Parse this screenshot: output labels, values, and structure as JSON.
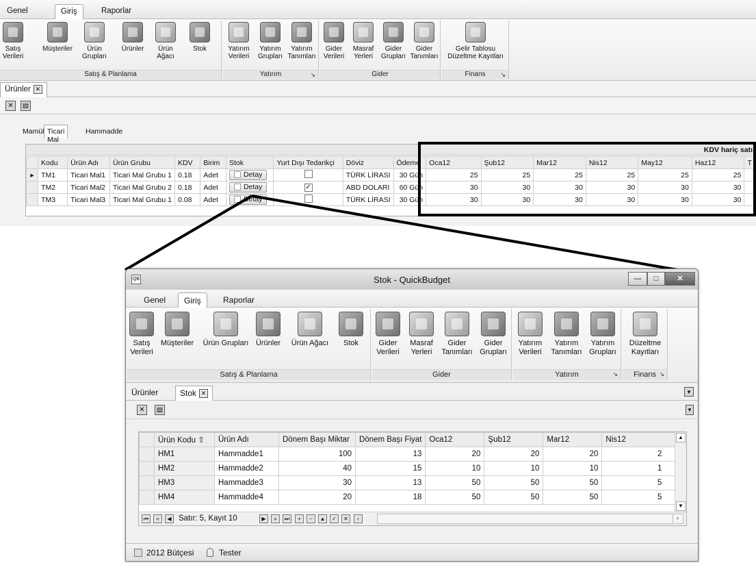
{
  "top": {
    "tabs": [
      "Genel",
      "Giriş",
      "Raporlar"
    ],
    "active_tab": "Giriş",
    "groups": [
      {
        "caption": "Satış & Planlama",
        "buttons": [
          "Satış Verileri",
          "Müşteriler",
          "Ürün Grupları",
          "Ürünler",
          "Ürün Ağacı",
          "Stok"
        ],
        "icons": [
          "sales-data-icon",
          "customers-icon",
          "product-groups-icon",
          "products-icon",
          "product-tree-icon",
          "stock-icon"
        ]
      },
      {
        "caption": "Yatırım",
        "buttons": [
          "Yatırım Verileri",
          "Yatırım Grupları",
          "Yatırım Tanımları"
        ],
        "icons": [
          "investment-data-icon",
          "investment-groups-icon",
          "investment-definitions-icon"
        ]
      },
      {
        "caption": "Gider",
        "buttons": [
          "Gider Verileri",
          "Masraf Yerleri",
          "Gider Grupları",
          "Gider Tanımları"
        ],
        "icons": [
          "expense-data-icon",
          "cost-centers-icon",
          "expense-groups-icon",
          "expense-definitions-icon"
        ]
      },
      {
        "caption": "Finans",
        "buttons": [
          "Gelir Tablosu Düzeltme Kayıtları"
        ],
        "icons": [
          "income-statement-icon"
        ]
      }
    ],
    "doc_tab": "Ürünler",
    "sub_tabs": [
      "Mamül",
      "Ticari Mal",
      "Hammadde"
    ],
    "active_sub_tab": "Ticari Mal",
    "band_label": "KDV hariç satı",
    "columns": [
      "Kodu",
      "Ürün Adı",
      "Ürün Grubu",
      "KDV",
      "Birim",
      "Stok",
      "Yurt Dışı Tedarikçi",
      "Döviz",
      "Ödeme",
      "Oca12",
      "Şub12",
      "Mar12",
      "Nis12",
      "May12",
      "Haz12",
      "T"
    ],
    "detay_label": "Detay",
    "rows": [
      {
        "code": "TM1",
        "name": "Ticari Mal1",
        "group": "Ticari Mal Grubu 1",
        "kdv": "0.18",
        "unit": "Adet",
        "foreign": false,
        "currency": "TÜRK LİRASI",
        "payment": "30 Gün",
        "months": [
          "25",
          "25",
          "25",
          "25",
          "25",
          "25"
        ]
      },
      {
        "code": "TM2",
        "name": "Ticari Mal2",
        "group": "Ticari Mal Grubu 2",
        "kdv": "0.18",
        "unit": "Adet",
        "foreign": true,
        "currency": "ABD DOLARI",
        "payment": "60 Gün",
        "months": [
          "30",
          "30",
          "30",
          "30",
          "30",
          "30"
        ]
      },
      {
        "code": "TM3",
        "name": "Ticari Mal3",
        "group": "Ticari Mal Grubu 1",
        "kdv": "0.08",
        "unit": "Adet",
        "foreign": false,
        "currency": "TÜRK LİRASI",
        "payment": "30 Gün",
        "months": [
          "30",
          "30",
          "30",
          "30",
          "30",
          "30"
        ]
      }
    ]
  },
  "window": {
    "title": "Stok - QuickBudget",
    "app_icon": "QB",
    "tabs": [
      "Genel",
      "Giriş",
      "Raporlar"
    ],
    "active_tab": "Giriş",
    "groups": [
      {
        "caption": "Satış & Planlama",
        "buttons": [
          "Satış Verileri",
          "Müşteriler",
          "Ürün Grupları",
          "Ürünler",
          "Ürün Ağacı",
          "Stok"
        ]
      },
      {
        "caption": "Gider",
        "buttons": [
          "Gider Verileri",
          "Masraf Yerleri",
          "Gider Tanımları",
          "Gider Grupları"
        ]
      },
      {
        "caption": "Yatırım",
        "buttons": [
          "Yatırım Verileri",
          "Yatırım Tanımları",
          "Yatırım Grupları"
        ]
      },
      {
        "caption": "Finans",
        "buttons": [
          "Düzeltme Kayıtları"
        ]
      }
    ],
    "doc_tabs": [
      "Ürünler",
      "Stok"
    ],
    "active_doc_tab": "Stok",
    "columns": [
      "Ürün Kodu",
      "Ürün Adı",
      "Dönem Başı Miktar",
      "Dönem Başı Fiyat",
      "Oca12",
      "Şub12",
      "Mar12",
      "Nis12"
    ],
    "sort_glyph": "⇧",
    "rows": [
      {
        "code": "HM1",
        "name": "Hammadde1",
        "qty": "100",
        "price": "13",
        "m": [
          "20",
          "20",
          "20",
          "2"
        ]
      },
      {
        "code": "HM2",
        "name": "Hammadde2",
        "qty": "40",
        "price": "15",
        "m": [
          "10",
          "10",
          "10",
          "1"
        ]
      },
      {
        "code": "HM3",
        "name": "Hammadde3",
        "qty": "30",
        "price": "13",
        "m": [
          "50",
          "50",
          "50",
          "5"
        ]
      },
      {
        "code": "HM4",
        "name": "Hammadde4",
        "qty": "20",
        "price": "18",
        "m": [
          "50",
          "50",
          "50",
          "5"
        ]
      }
    ],
    "nav_text": "Satır: 5, Kayıt 10",
    "status_budget": "2012 Bütçesi",
    "status_user": "Tester"
  }
}
